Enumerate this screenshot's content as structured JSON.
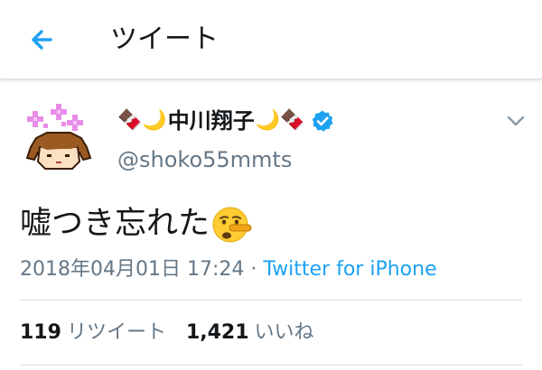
{
  "header": {
    "title": "ツイート",
    "back_icon": "arrow-left-icon"
  },
  "author": {
    "name_prefix_emoji": "🍫🌙",
    "display_name": "中川翔子",
    "name_suffix_emoji": "🌙🍫",
    "verified": true,
    "handle": "@shoko55mmts",
    "avatar_icon": "pixel-character-avatar"
  },
  "tweet": {
    "text": "嘘つき忘れた",
    "emoji_icon": "lying-face-emoji",
    "timestamp": "2018年04月01日 17:24",
    "separator": "·",
    "source": "Twitter for iPhone"
  },
  "stats": {
    "retweets": "119",
    "retweets_label": "リツイート",
    "likes": "1,421",
    "likes_label": "いいね"
  },
  "colors": {
    "accent": "#1da1f2",
    "text": "#14171a",
    "secondary": "#657786",
    "divider": "#d8dde1"
  }
}
